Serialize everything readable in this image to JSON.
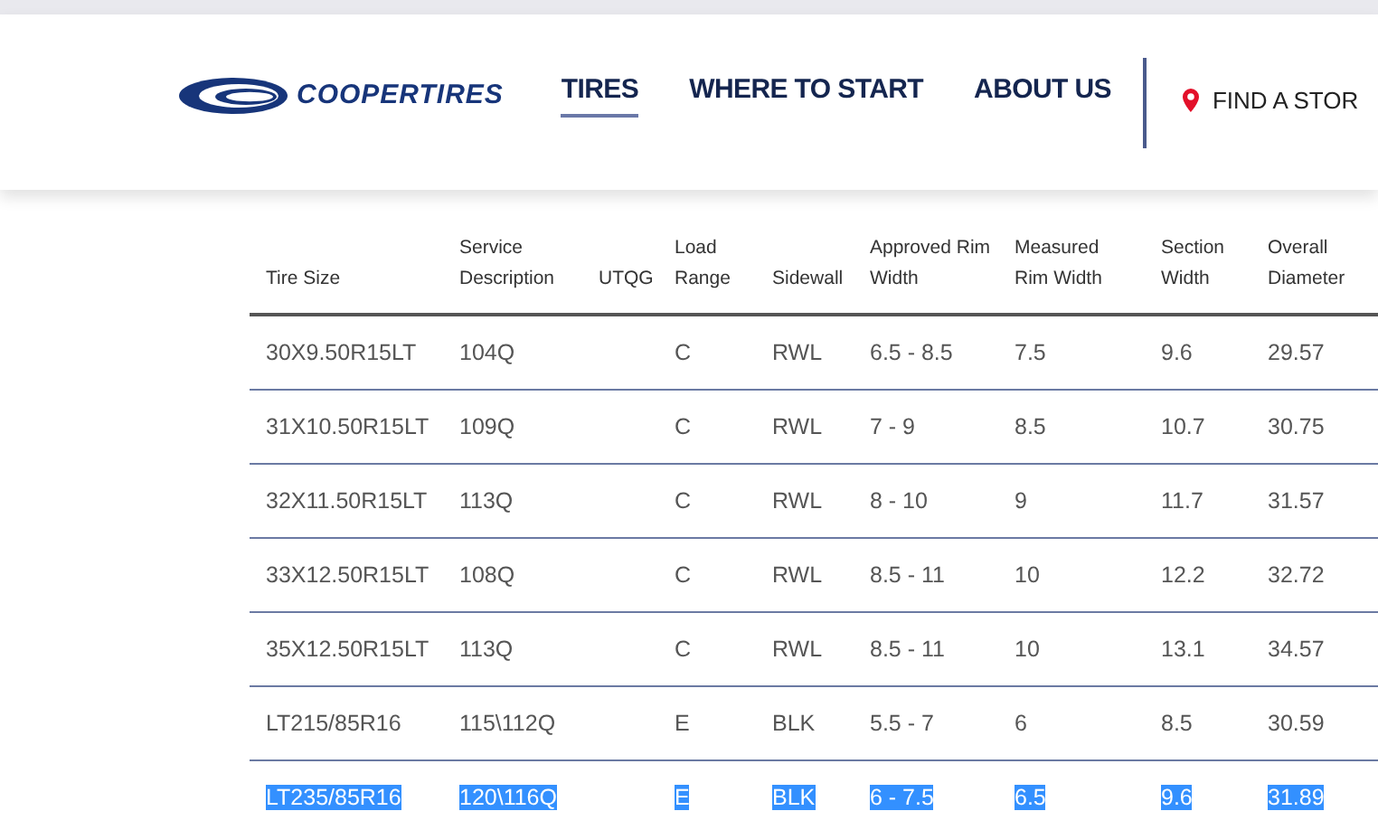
{
  "header": {
    "logo_text": "COOPERTIRES",
    "nav": [
      {
        "label": "TIRES",
        "selected": true
      },
      {
        "label": "WHERE TO START",
        "selected": false
      },
      {
        "label": "ABOUT US",
        "selected": false
      }
    ],
    "find_store": "FIND A STOR"
  },
  "table": {
    "columns": [
      "Tire Size",
      "Service Description",
      "UTQG",
      "Load Range",
      "Sidewall",
      "Approved Rim Width",
      "Measured Rim Width",
      "Section Width",
      "Overall Diameter"
    ],
    "rows": [
      {
        "cells": [
          "30X9.50R15LT",
          "104Q",
          "",
          "C",
          "RWL",
          "6.5 - 8.5",
          "7.5",
          "9.6",
          "29.57"
        ],
        "selected": false
      },
      {
        "cells": [
          "31X10.50R15LT",
          "109Q",
          "",
          "C",
          "RWL",
          "7 - 9",
          "8.5",
          "10.7",
          "30.75"
        ],
        "selected": false
      },
      {
        "cells": [
          "32X11.50R15LT",
          "113Q",
          "",
          "C",
          "RWL",
          "8 - 10",
          "9",
          "11.7",
          "31.57"
        ],
        "selected": false
      },
      {
        "cells": [
          "33X12.50R15LT",
          "108Q",
          "",
          "C",
          "RWL",
          "8.5 - 11",
          "10",
          "12.2",
          "32.72"
        ],
        "selected": false
      },
      {
        "cells": [
          "35X12.50R15LT",
          "113Q",
          "",
          "C",
          "RWL",
          "8.5 - 11",
          "10",
          "13.1",
          "34.57"
        ],
        "selected": false
      },
      {
        "cells": [
          "LT215/85R16",
          "115\\112Q",
          "",
          "E",
          "BLK",
          "5.5 - 7",
          "6",
          "8.5",
          "30.59"
        ],
        "selected": false
      },
      {
        "cells": [
          "LT235/85R16",
          "120\\116Q",
          "",
          "E",
          "BLK",
          "6 - 7.5",
          "6.5",
          "9.6",
          "31.89"
        ],
        "selected": true
      }
    ]
  }
}
